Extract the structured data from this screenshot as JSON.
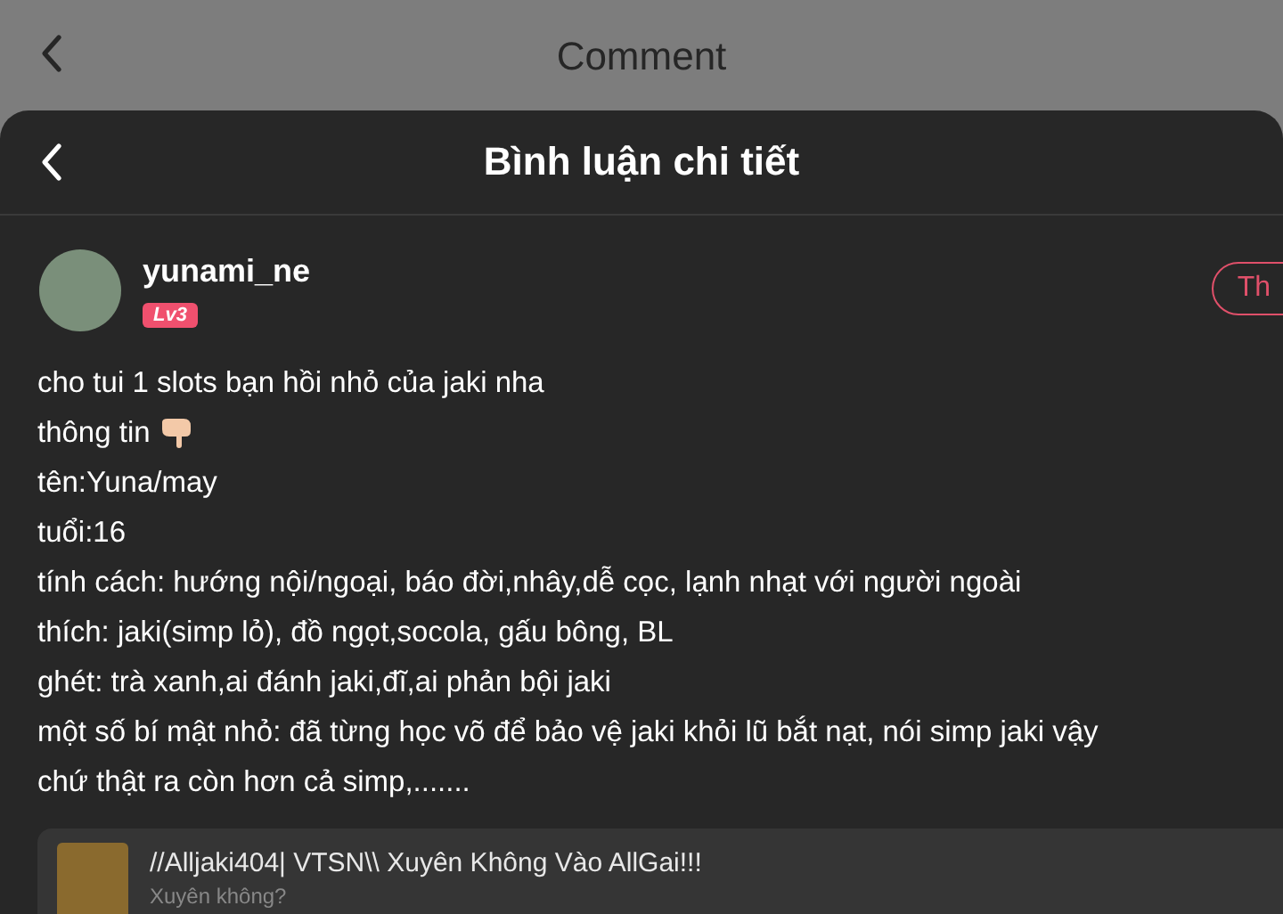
{
  "background_page": {
    "title": "Comment"
  },
  "sheet": {
    "title": "Bình luận chi tiết"
  },
  "comment": {
    "username": "yunami_ne",
    "level_badge": "Lv3",
    "action_button": "Th",
    "lines": [
      {
        "kind": "plain",
        "text": "cho tui 1 slots bạn hồi nhỏ của jaki nha"
      },
      {
        "kind": "pointing",
        "text": "thông tin"
      },
      {
        "kind": "plain",
        "text": "tên:Yuna/may"
      },
      {
        "kind": "plain",
        "text": "tuổi:16"
      },
      {
        "kind": "plain",
        "text": "tính cách: hướng nội/ngoại, báo đời,nhây,dễ cọc, lạnh nhạt với người ngoài"
      },
      {
        "kind": "plain",
        "text": "thích: jaki(simp lỏ), đồ ngọt,socola, gấu bông, BL"
      },
      {
        "kind": "plain",
        "text": "ghét: trà xanh,ai đánh jaki,đĩ,ai phản bội jaki"
      },
      {
        "kind": "plain",
        "text": "một số bí mật nhỏ: đã từng học võ để bảo vệ jaki khỏi lũ bắt nạt, nói simp jaki vậy"
      },
      {
        "kind": "plain",
        "text": "chứ thật ra còn hơn cả simp,......."
      }
    ]
  },
  "linked_story": {
    "title": "//Alljaki404| VTSN\\\\ Xuyên Không Vào AllGai!!!",
    "subtitle": "Xuyên không?"
  }
}
